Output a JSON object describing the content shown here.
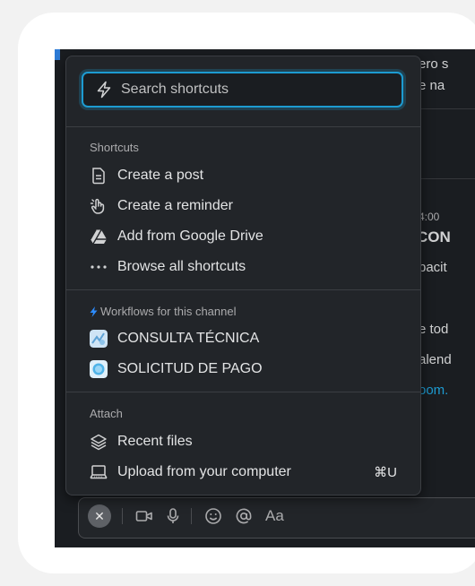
{
  "background_text": {
    "line1": "ero s",
    "line2": "e na",
    "time": "4:00",
    "heading": "CON",
    "line3": "pacit",
    "line4": "e tod",
    "line5": "alend",
    "link": "oom."
  },
  "search": {
    "placeholder": "Search shortcuts",
    "value": ""
  },
  "shortcuts": {
    "header": "Shortcuts",
    "items": [
      {
        "label": "Create a post",
        "icon": "document-icon"
      },
      {
        "label": "Create a reminder",
        "icon": "hand-icon"
      },
      {
        "label": "Add from Google Drive",
        "icon": "google-drive-icon"
      },
      {
        "label": "Browse all shortcuts",
        "icon": "more-dots-icon"
      }
    ]
  },
  "workflows": {
    "header": "Workflows for this channel",
    "items": [
      {
        "label": "CONSULTA TÉCNICA",
        "icon": "workflow-tecnica-icon"
      },
      {
        "label": "SOLICITUD DE PAGO",
        "icon": "workflow-pago-icon"
      }
    ]
  },
  "attach": {
    "header": "Attach",
    "items": [
      {
        "label": "Recent files",
        "icon": "layers-icon"
      },
      {
        "label": "Upload from your computer",
        "icon": "laptop-icon",
        "shortcut": "⌘U"
      }
    ]
  },
  "composer": {
    "format_label": "Aa"
  },
  "colors": {
    "accent": "#1d9bd1",
    "bolt": "#2d8cff",
    "popup_bg": "#222529",
    "app_bg": "#1a1d21"
  }
}
